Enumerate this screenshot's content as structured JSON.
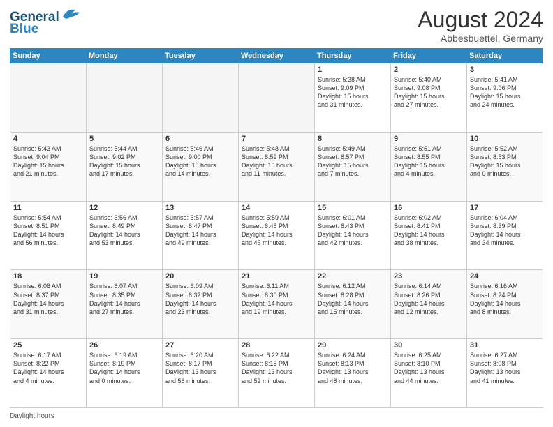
{
  "header": {
    "logo_line1": "General",
    "logo_line2": "Blue",
    "month_year": "August 2024",
    "location": "Abbesbuettel, Germany"
  },
  "days_of_week": [
    "Sunday",
    "Monday",
    "Tuesday",
    "Wednesday",
    "Thursday",
    "Friday",
    "Saturday"
  ],
  "weeks": [
    [
      {
        "num": "",
        "info": ""
      },
      {
        "num": "",
        "info": ""
      },
      {
        "num": "",
        "info": ""
      },
      {
        "num": "",
        "info": ""
      },
      {
        "num": "1",
        "info": "Sunrise: 5:38 AM\nSunset: 9:09 PM\nDaylight: 15 hours\nand 31 minutes."
      },
      {
        "num": "2",
        "info": "Sunrise: 5:40 AM\nSunset: 9:08 PM\nDaylight: 15 hours\nand 27 minutes."
      },
      {
        "num": "3",
        "info": "Sunrise: 5:41 AM\nSunset: 9:06 PM\nDaylight: 15 hours\nand 24 minutes."
      }
    ],
    [
      {
        "num": "4",
        "info": "Sunrise: 5:43 AM\nSunset: 9:04 PM\nDaylight: 15 hours\nand 21 minutes."
      },
      {
        "num": "5",
        "info": "Sunrise: 5:44 AM\nSunset: 9:02 PM\nDaylight: 15 hours\nand 17 minutes."
      },
      {
        "num": "6",
        "info": "Sunrise: 5:46 AM\nSunset: 9:00 PM\nDaylight: 15 hours\nand 14 minutes."
      },
      {
        "num": "7",
        "info": "Sunrise: 5:48 AM\nSunset: 8:59 PM\nDaylight: 15 hours\nand 11 minutes."
      },
      {
        "num": "8",
        "info": "Sunrise: 5:49 AM\nSunset: 8:57 PM\nDaylight: 15 hours\nand 7 minutes."
      },
      {
        "num": "9",
        "info": "Sunrise: 5:51 AM\nSunset: 8:55 PM\nDaylight: 15 hours\nand 4 minutes."
      },
      {
        "num": "10",
        "info": "Sunrise: 5:52 AM\nSunset: 8:53 PM\nDaylight: 15 hours\nand 0 minutes."
      }
    ],
    [
      {
        "num": "11",
        "info": "Sunrise: 5:54 AM\nSunset: 8:51 PM\nDaylight: 14 hours\nand 56 minutes."
      },
      {
        "num": "12",
        "info": "Sunrise: 5:56 AM\nSunset: 8:49 PM\nDaylight: 14 hours\nand 53 minutes."
      },
      {
        "num": "13",
        "info": "Sunrise: 5:57 AM\nSunset: 8:47 PM\nDaylight: 14 hours\nand 49 minutes."
      },
      {
        "num": "14",
        "info": "Sunrise: 5:59 AM\nSunset: 8:45 PM\nDaylight: 14 hours\nand 45 minutes."
      },
      {
        "num": "15",
        "info": "Sunrise: 6:01 AM\nSunset: 8:43 PM\nDaylight: 14 hours\nand 42 minutes."
      },
      {
        "num": "16",
        "info": "Sunrise: 6:02 AM\nSunset: 8:41 PM\nDaylight: 14 hours\nand 38 minutes."
      },
      {
        "num": "17",
        "info": "Sunrise: 6:04 AM\nSunset: 8:39 PM\nDaylight: 14 hours\nand 34 minutes."
      }
    ],
    [
      {
        "num": "18",
        "info": "Sunrise: 6:06 AM\nSunset: 8:37 PM\nDaylight: 14 hours\nand 31 minutes."
      },
      {
        "num": "19",
        "info": "Sunrise: 6:07 AM\nSunset: 8:35 PM\nDaylight: 14 hours\nand 27 minutes."
      },
      {
        "num": "20",
        "info": "Sunrise: 6:09 AM\nSunset: 8:32 PM\nDaylight: 14 hours\nand 23 minutes."
      },
      {
        "num": "21",
        "info": "Sunrise: 6:11 AM\nSunset: 8:30 PM\nDaylight: 14 hours\nand 19 minutes."
      },
      {
        "num": "22",
        "info": "Sunrise: 6:12 AM\nSunset: 8:28 PM\nDaylight: 14 hours\nand 15 minutes."
      },
      {
        "num": "23",
        "info": "Sunrise: 6:14 AM\nSunset: 8:26 PM\nDaylight: 14 hours\nand 12 minutes."
      },
      {
        "num": "24",
        "info": "Sunrise: 6:16 AM\nSunset: 8:24 PM\nDaylight: 14 hours\nand 8 minutes."
      }
    ],
    [
      {
        "num": "25",
        "info": "Sunrise: 6:17 AM\nSunset: 8:22 PM\nDaylight: 14 hours\nand 4 minutes."
      },
      {
        "num": "26",
        "info": "Sunrise: 6:19 AM\nSunset: 8:19 PM\nDaylight: 14 hours\nand 0 minutes."
      },
      {
        "num": "27",
        "info": "Sunrise: 6:20 AM\nSunset: 8:17 PM\nDaylight: 13 hours\nand 56 minutes."
      },
      {
        "num": "28",
        "info": "Sunrise: 6:22 AM\nSunset: 8:15 PM\nDaylight: 13 hours\nand 52 minutes."
      },
      {
        "num": "29",
        "info": "Sunrise: 6:24 AM\nSunset: 8:13 PM\nDaylight: 13 hours\nand 48 minutes."
      },
      {
        "num": "30",
        "info": "Sunrise: 6:25 AM\nSunset: 8:10 PM\nDaylight: 13 hours\nand 44 minutes."
      },
      {
        "num": "31",
        "info": "Sunrise: 6:27 AM\nSunset: 8:08 PM\nDaylight: 13 hours\nand 41 minutes."
      }
    ]
  ],
  "footer": {
    "text": "Daylight hours"
  }
}
